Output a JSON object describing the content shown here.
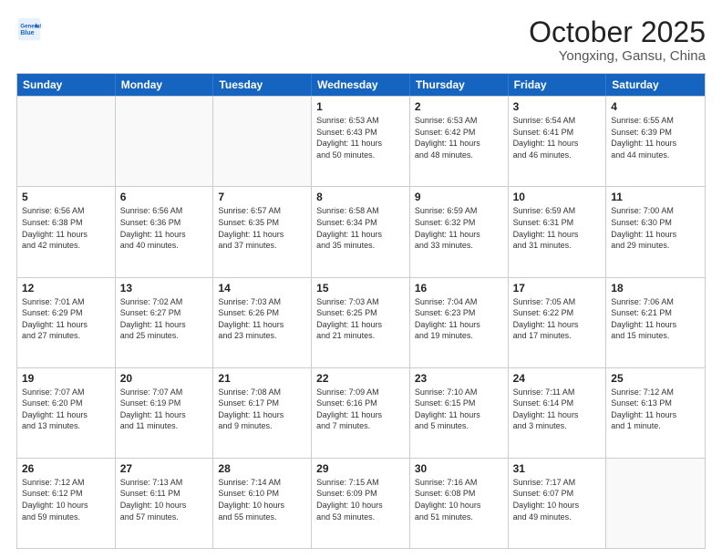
{
  "header": {
    "logo_general": "General",
    "logo_blue": "Blue",
    "month_title": "October 2025",
    "location": "Yongxing, Gansu, China"
  },
  "weekdays": [
    "Sunday",
    "Monday",
    "Tuesday",
    "Wednesday",
    "Thursday",
    "Friday",
    "Saturday"
  ],
  "rows": [
    [
      {
        "day": "",
        "text": ""
      },
      {
        "day": "",
        "text": ""
      },
      {
        "day": "",
        "text": ""
      },
      {
        "day": "1",
        "text": "Sunrise: 6:53 AM\nSunset: 6:43 PM\nDaylight: 11 hours\nand 50 minutes."
      },
      {
        "day": "2",
        "text": "Sunrise: 6:53 AM\nSunset: 6:42 PM\nDaylight: 11 hours\nand 48 minutes."
      },
      {
        "day": "3",
        "text": "Sunrise: 6:54 AM\nSunset: 6:41 PM\nDaylight: 11 hours\nand 46 minutes."
      },
      {
        "day": "4",
        "text": "Sunrise: 6:55 AM\nSunset: 6:39 PM\nDaylight: 11 hours\nand 44 minutes."
      }
    ],
    [
      {
        "day": "5",
        "text": "Sunrise: 6:56 AM\nSunset: 6:38 PM\nDaylight: 11 hours\nand 42 minutes."
      },
      {
        "day": "6",
        "text": "Sunrise: 6:56 AM\nSunset: 6:36 PM\nDaylight: 11 hours\nand 40 minutes."
      },
      {
        "day": "7",
        "text": "Sunrise: 6:57 AM\nSunset: 6:35 PM\nDaylight: 11 hours\nand 37 minutes."
      },
      {
        "day": "8",
        "text": "Sunrise: 6:58 AM\nSunset: 6:34 PM\nDaylight: 11 hours\nand 35 minutes."
      },
      {
        "day": "9",
        "text": "Sunrise: 6:59 AM\nSunset: 6:32 PM\nDaylight: 11 hours\nand 33 minutes."
      },
      {
        "day": "10",
        "text": "Sunrise: 6:59 AM\nSunset: 6:31 PM\nDaylight: 11 hours\nand 31 minutes."
      },
      {
        "day": "11",
        "text": "Sunrise: 7:00 AM\nSunset: 6:30 PM\nDaylight: 11 hours\nand 29 minutes."
      }
    ],
    [
      {
        "day": "12",
        "text": "Sunrise: 7:01 AM\nSunset: 6:29 PM\nDaylight: 11 hours\nand 27 minutes."
      },
      {
        "day": "13",
        "text": "Sunrise: 7:02 AM\nSunset: 6:27 PM\nDaylight: 11 hours\nand 25 minutes."
      },
      {
        "day": "14",
        "text": "Sunrise: 7:03 AM\nSunset: 6:26 PM\nDaylight: 11 hours\nand 23 minutes."
      },
      {
        "day": "15",
        "text": "Sunrise: 7:03 AM\nSunset: 6:25 PM\nDaylight: 11 hours\nand 21 minutes."
      },
      {
        "day": "16",
        "text": "Sunrise: 7:04 AM\nSunset: 6:23 PM\nDaylight: 11 hours\nand 19 minutes."
      },
      {
        "day": "17",
        "text": "Sunrise: 7:05 AM\nSunset: 6:22 PM\nDaylight: 11 hours\nand 17 minutes."
      },
      {
        "day": "18",
        "text": "Sunrise: 7:06 AM\nSunset: 6:21 PM\nDaylight: 11 hours\nand 15 minutes."
      }
    ],
    [
      {
        "day": "19",
        "text": "Sunrise: 7:07 AM\nSunset: 6:20 PM\nDaylight: 11 hours\nand 13 minutes."
      },
      {
        "day": "20",
        "text": "Sunrise: 7:07 AM\nSunset: 6:19 PM\nDaylight: 11 hours\nand 11 minutes."
      },
      {
        "day": "21",
        "text": "Sunrise: 7:08 AM\nSunset: 6:17 PM\nDaylight: 11 hours\nand 9 minutes."
      },
      {
        "day": "22",
        "text": "Sunrise: 7:09 AM\nSunset: 6:16 PM\nDaylight: 11 hours\nand 7 minutes."
      },
      {
        "day": "23",
        "text": "Sunrise: 7:10 AM\nSunset: 6:15 PM\nDaylight: 11 hours\nand 5 minutes."
      },
      {
        "day": "24",
        "text": "Sunrise: 7:11 AM\nSunset: 6:14 PM\nDaylight: 11 hours\nand 3 minutes."
      },
      {
        "day": "25",
        "text": "Sunrise: 7:12 AM\nSunset: 6:13 PM\nDaylight: 11 hours\nand 1 minute."
      }
    ],
    [
      {
        "day": "26",
        "text": "Sunrise: 7:12 AM\nSunset: 6:12 PM\nDaylight: 10 hours\nand 59 minutes."
      },
      {
        "day": "27",
        "text": "Sunrise: 7:13 AM\nSunset: 6:11 PM\nDaylight: 10 hours\nand 57 minutes."
      },
      {
        "day": "28",
        "text": "Sunrise: 7:14 AM\nSunset: 6:10 PM\nDaylight: 10 hours\nand 55 minutes."
      },
      {
        "day": "29",
        "text": "Sunrise: 7:15 AM\nSunset: 6:09 PM\nDaylight: 10 hours\nand 53 minutes."
      },
      {
        "day": "30",
        "text": "Sunrise: 7:16 AM\nSunset: 6:08 PM\nDaylight: 10 hours\nand 51 minutes."
      },
      {
        "day": "31",
        "text": "Sunrise: 7:17 AM\nSunset: 6:07 PM\nDaylight: 10 hours\nand 49 minutes."
      },
      {
        "day": "",
        "text": ""
      }
    ]
  ]
}
